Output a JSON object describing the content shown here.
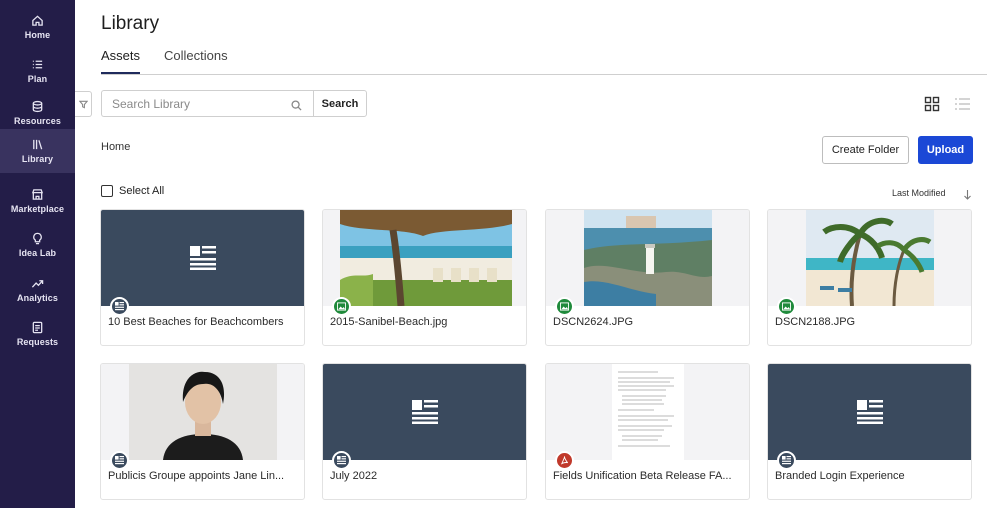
{
  "sidebar": {
    "items": [
      {
        "label": "Home",
        "icon": "home-icon"
      },
      {
        "label": "Plan",
        "icon": "list-icon"
      },
      {
        "label": "Resources",
        "icon": "database-icon"
      },
      {
        "label": "Library",
        "icon": "library-icon",
        "active": true
      },
      {
        "label": "Marketplace",
        "icon": "store-icon"
      },
      {
        "label": "Idea Lab",
        "icon": "lightbulb-icon"
      },
      {
        "label": "Analytics",
        "icon": "trend-icon"
      },
      {
        "label": "Requests",
        "icon": "clipboard-icon"
      }
    ]
  },
  "header": {
    "title": "Library",
    "tabs": [
      {
        "label": "Assets",
        "active": true
      },
      {
        "label": "Collections"
      }
    ]
  },
  "toolbar": {
    "search_placeholder": "Search Library",
    "search_button": "Search",
    "breadcrumb": "Home",
    "create_folder": "Create Folder",
    "upload": "Upload",
    "select_all": "Select All",
    "sort_label": "Last Modified"
  },
  "assets": [
    {
      "name": "10 Best Beaches for Beachcombers",
      "type": "doc"
    },
    {
      "name": "2015-Sanibel-Beach.jpg",
      "type": "img",
      "image": "beach-umbrella"
    },
    {
      "name": "DSCN2624.JPG",
      "type": "img",
      "image": "lighthouse-coast"
    },
    {
      "name": "DSCN2188.JPG",
      "type": "img",
      "image": "palm-beach"
    },
    {
      "name": "Publicis Groupe appoints Jane Lin...",
      "type": "doc",
      "image": "portrait"
    },
    {
      "name": "July 2022",
      "type": "doc"
    },
    {
      "name": "Fields Unification Beta Release FA...",
      "type": "pdf",
      "image": "document-page"
    },
    {
      "name": "Branded Login Experience",
      "type": "doc"
    }
  ],
  "colors": {
    "sidebar_bg": "#231d48",
    "sidebar_active": "#39335f",
    "accent": "#1b48d6",
    "doc_thumb": "#3a4a5e",
    "image_badge": "#1f8a3b",
    "pdf_badge": "#c0392b"
  }
}
